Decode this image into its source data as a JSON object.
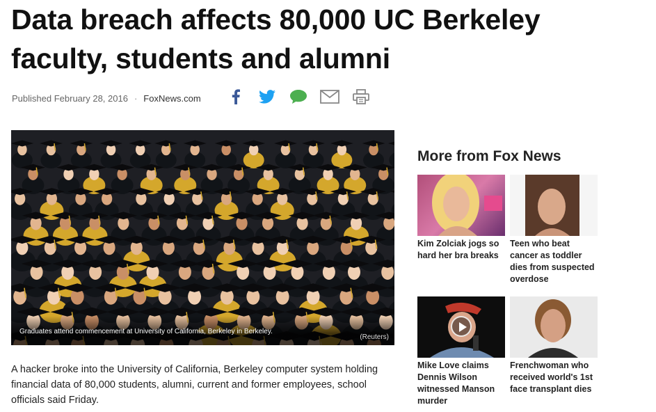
{
  "article": {
    "headline": "Data breach affects 80,000 UC Berkeley faculty, students and alumni",
    "published": "Published February 28, 2016",
    "separator": "·",
    "source": "FoxNews.com",
    "image_caption": "Graduates attend commencement at University of California, Berkeley in Berkeley.",
    "image_credit": "(Reuters)",
    "lead": "A hacker broke into the University of California, Berkeley computer system holding financial data of 80,000 students, alumni, current and former employees, school officials said Friday."
  },
  "share": [
    {
      "name": "facebook-icon",
      "color": "#3b5998"
    },
    {
      "name": "twitter-icon",
      "color": "#1da1f2"
    },
    {
      "name": "comment-icon",
      "color": "#4caf50"
    },
    {
      "name": "email-icon",
      "color": "#888888"
    },
    {
      "name": "print-icon",
      "color": "#888888"
    }
  ],
  "more": {
    "title": "More from Fox News",
    "items": [
      {
        "title": "Kim Zolciak jogs so hard her bra breaks",
        "thumb_icon": "photo-thumbnail"
      },
      {
        "title": "Teen who beat cancer as toddler dies from suspected overdose",
        "thumb_icon": "photo-thumbnail"
      },
      {
        "title": "Mike Love claims Dennis Wilson witnessed Manson murder",
        "thumb_icon": "video-thumbnail"
      },
      {
        "title": "Frenchwoman who received world's 1st face transplant dies",
        "thumb_icon": "photo-thumbnail"
      }
    ]
  }
}
